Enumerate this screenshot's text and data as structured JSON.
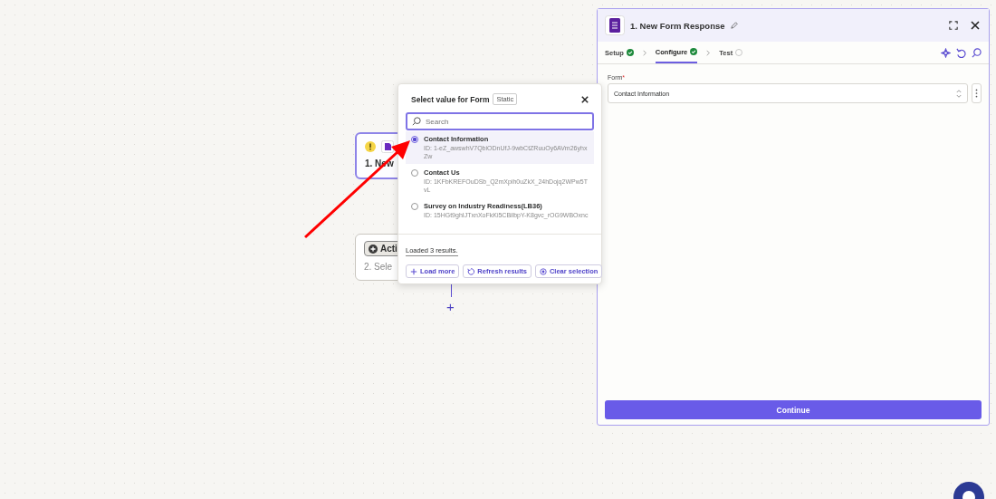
{
  "canvas": {
    "nodes": [
      {
        "kind": "trigger",
        "warning": true,
        "title": "1. New"
      },
      {
        "kind": "action",
        "chip": "Acti",
        "title": "2. Sele"
      }
    ],
    "add_step": "+"
  },
  "popup": {
    "title": "Select value for Form",
    "badge": "Static",
    "search": {
      "placeholder": "Search"
    },
    "options": [
      {
        "name": "Contact Information",
        "id": "ID: 1-eZ_awswhV7QbiODnUfJ-9wbCtZRuuOy6AVm26yhxZw",
        "selected": true
      },
      {
        "name": "Contact Us",
        "id": "ID: 1KFbKREFOuDSb_Q2mXpih0uZkX_24hDojq2WPw5TvL",
        "selected": false
      },
      {
        "name": "Survey on Industry Readiness(LB36)",
        "id": "ID: 15HGt9ghIJTxnXoFkKi5CBilbpY-K8gvc_rOG9WBOxnc",
        "selected": false
      }
    ],
    "status": "Loaded 3 results.",
    "buttons": [
      {
        "kind": "load",
        "label": "Load more"
      },
      {
        "kind": "refresh",
        "label": "Refresh results"
      },
      {
        "kind": "clear",
        "label": "Clear selection"
      }
    ]
  },
  "panel": {
    "title": "1. New Form Response",
    "steps": [
      {
        "label": "Setup",
        "done": true,
        "selected": false
      },
      {
        "label": "Configure",
        "done": true,
        "selected": true
      },
      {
        "label": "Test",
        "done": false,
        "selected": false
      }
    ],
    "field": {
      "label": "Form",
      "required_mark": "*",
      "value": "Contact Information"
    },
    "continue": "Continue"
  }
}
